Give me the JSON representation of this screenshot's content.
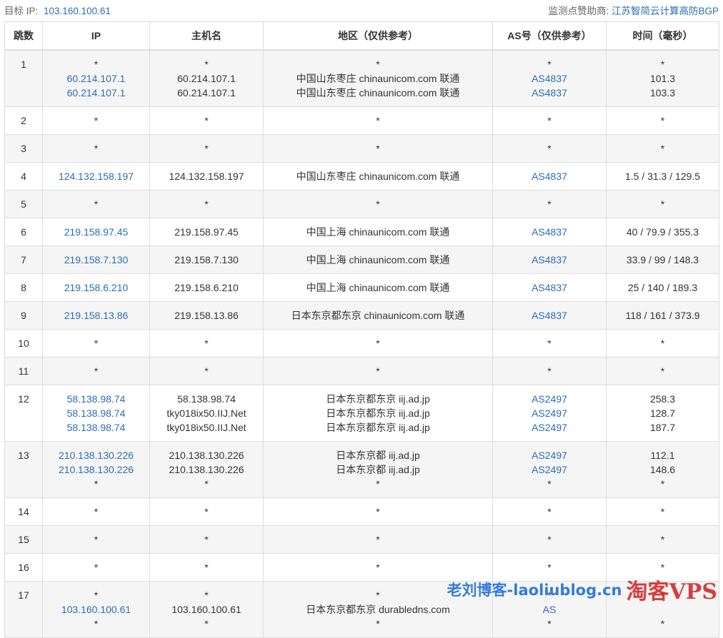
{
  "header": {
    "target_label": "目标 IP:",
    "target_ip": "103.160.100.61",
    "sponsor_label": "监测点赞助商:",
    "sponsor_name": "江苏智简云计算高防BGP"
  },
  "table": {
    "columns": [
      "跳数",
      "IP",
      "主机名",
      "地区（仅供参考）",
      "AS号（仅供参考）",
      "时间（毫秒）"
    ],
    "rows": [
      {
        "hop": "1",
        "ip": [
          "*",
          "60.214.107.1",
          "60.214.107.1"
        ],
        "host": [
          "*",
          "60.214.107.1",
          "60.214.107.1"
        ],
        "region": [
          "*",
          "中国山东枣庄 chinaunicom.com 联通",
          "中国山东枣庄 chinaunicom.com 联通"
        ],
        "asn": [
          "*",
          "AS4837",
          "AS4837"
        ],
        "time": [
          "*",
          "101.3",
          "103.3"
        ]
      },
      {
        "hop": "2",
        "ip": [
          "*"
        ],
        "host": [
          "*"
        ],
        "region": [
          "*"
        ],
        "asn": [
          "*"
        ],
        "time": [
          "*"
        ]
      },
      {
        "hop": "3",
        "ip": [
          "*"
        ],
        "host": [
          "*"
        ],
        "region": [
          "*"
        ],
        "asn": [
          "*"
        ],
        "time": [
          "*"
        ]
      },
      {
        "hop": "4",
        "ip": [
          "124.132.158.197"
        ],
        "host": [
          "124.132.158.197"
        ],
        "region": [
          "中国山东枣庄 chinaunicom.com 联通"
        ],
        "asn": [
          "AS4837"
        ],
        "time": [
          "1.5 / 31.3 / 129.5"
        ]
      },
      {
        "hop": "5",
        "ip": [
          "*"
        ],
        "host": [
          "*"
        ],
        "region": [
          "*"
        ],
        "asn": [
          "*"
        ],
        "time": [
          "*"
        ]
      },
      {
        "hop": "6",
        "ip": [
          "219.158.97.45"
        ],
        "host": [
          "219.158.97.45"
        ],
        "region": [
          "中国上海 chinaunicom.com 联通"
        ],
        "asn": [
          "AS4837"
        ],
        "time": [
          "40 / 79.9 / 355.3"
        ]
      },
      {
        "hop": "7",
        "ip": [
          "219.158.7.130"
        ],
        "host": [
          "219.158.7.130"
        ],
        "region": [
          "中国上海 chinaunicom.com 联通"
        ],
        "asn": [
          "AS4837"
        ],
        "time": [
          "33.9 / 99 / 148.3"
        ]
      },
      {
        "hop": "8",
        "ip": [
          "219.158.6.210"
        ],
        "host": [
          "219.158.6.210"
        ],
        "region": [
          "中国上海 chinaunicom.com 联通"
        ],
        "asn": [
          "AS4837"
        ],
        "time": [
          "25 / 140 / 189.3"
        ]
      },
      {
        "hop": "9",
        "ip": [
          "219.158.13.86"
        ],
        "host": [
          "219.158.13.86"
        ],
        "region": [
          "日本东京都东京 chinaunicom.com 联通"
        ],
        "asn": [
          "AS4837"
        ],
        "time": [
          "118 / 161 / 373.9"
        ]
      },
      {
        "hop": "10",
        "ip": [
          "*"
        ],
        "host": [
          "*"
        ],
        "region": [
          "*"
        ],
        "asn": [
          "*"
        ],
        "time": [
          "*"
        ]
      },
      {
        "hop": "11",
        "ip": [
          "*"
        ],
        "host": [
          "*"
        ],
        "region": [
          "*"
        ],
        "asn": [
          "*"
        ],
        "time": [
          "*"
        ]
      },
      {
        "hop": "12",
        "ip": [
          "58.138.98.74",
          "58.138.98.74",
          "58.138.98.74"
        ],
        "host": [
          "58.138.98.74",
          "tky018ix50.IIJ.Net",
          "tky018ix50.IIJ.Net"
        ],
        "region": [
          "日本东京都东京 iij.ad.jp",
          "日本东京都东京 iij.ad.jp",
          "日本东京都东京 iij.ad.jp"
        ],
        "asn": [
          "AS2497",
          "AS2497",
          "AS2497"
        ],
        "time": [
          "258.3",
          "128.7",
          "187.7"
        ]
      },
      {
        "hop": "13",
        "ip": [
          "210.138.130.226",
          "210.138.130.226",
          "*"
        ],
        "host": [
          "210.138.130.226",
          "210.138.130.226",
          "*"
        ],
        "region": [
          "日本东京都 iij.ad.jp",
          "日本东京都 iij.ad.jp",
          "*"
        ],
        "asn": [
          "AS2497",
          "AS2497",
          "*"
        ],
        "time": [
          "112.1",
          "148.6",
          "*"
        ]
      },
      {
        "hop": "14",
        "ip": [
          "*"
        ],
        "host": [
          "*"
        ],
        "region": [
          "*"
        ],
        "asn": [
          "*"
        ],
        "time": [
          "*"
        ]
      },
      {
        "hop": "15",
        "ip": [
          "*"
        ],
        "host": [
          "*"
        ],
        "region": [
          "*"
        ],
        "asn": [
          "*"
        ],
        "time": [
          "*"
        ]
      },
      {
        "hop": "16",
        "ip": [
          "*"
        ],
        "host": [
          "*"
        ],
        "region": [
          "*"
        ],
        "asn": [
          "*"
        ],
        "time": [
          "*"
        ]
      },
      {
        "hop": "17",
        "ip": [
          "*",
          "103.160.100.61",
          "*"
        ],
        "host": [
          "*",
          "103.160.100.61",
          "*"
        ],
        "region": [
          "*",
          "日本东京都东京 durabledns.com",
          "*"
        ],
        "asn": [
          "*",
          "AS",
          "*"
        ],
        "time": [
          "*",
          "",
          "*"
        ]
      }
    ]
  },
  "watermark": {
    "blue_text": "老刘博客-laoliublog.cn",
    "red_text": "淘客VPS"
  },
  "colors": {
    "link": "#2a6db5",
    "stripe": "#f5f5f5",
    "border": "#dddddd"
  }
}
